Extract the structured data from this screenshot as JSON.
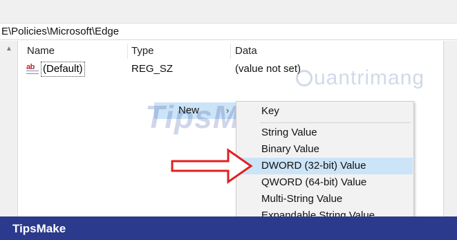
{
  "address": {
    "path": "E\\Policies\\Microsoft\\Edge"
  },
  "columns": {
    "name": "Name",
    "type": "Type",
    "data": "Data"
  },
  "rows": [
    {
      "icon": "ab",
      "name": "(Default)",
      "type": "REG_SZ",
      "data": "(value not set)"
    }
  ],
  "context_menu": {
    "new_label": "New",
    "new_chevron": "›"
  },
  "submenu": {
    "items": [
      {
        "label": "Key"
      },
      {
        "label": "String Value"
      },
      {
        "label": "Binary Value"
      },
      {
        "label": "DWORD (32-bit) Value"
      },
      {
        "label": "QWORD (64-bit) Value"
      },
      {
        "label": "Multi-String Value"
      },
      {
        "label": "Expandable String Value"
      }
    ],
    "highlighted_index": 3
  },
  "watermarks": {
    "tipsmake": "TipsMake",
    "quantrimang": "uantrimang"
  },
  "footer": {
    "brand": "TipsMake"
  },
  "colors": {
    "footer_bg": "#2b3a8c",
    "highlight": "#cce4f7",
    "annotation_arrow": "#e02020"
  },
  "icons": {
    "value_icon": "string-value-icon",
    "annotation": "red-arrow-icon"
  }
}
